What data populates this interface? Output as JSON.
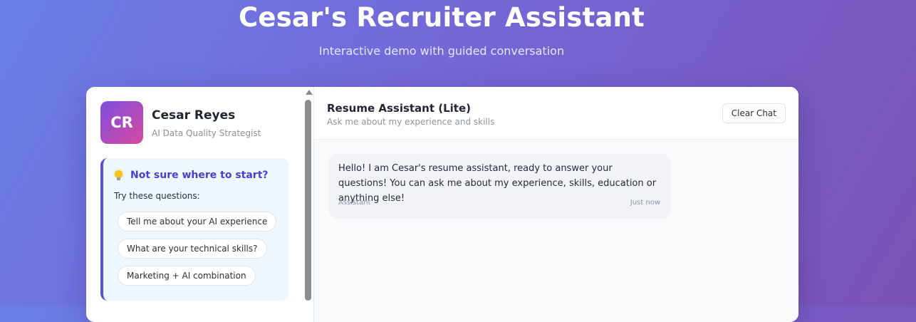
{
  "page": {
    "title": "Cesar's Recruiter Assistant",
    "subtitle": "Interactive demo with guided conversation"
  },
  "profile": {
    "initials": "CR",
    "name": "Cesar Reyes",
    "role": "AI Data Quality Strategist"
  },
  "suggestions": {
    "icon": "lightbulb-icon",
    "title": "Not sure where to start?",
    "prompt": "Try these questions:",
    "items": [
      "Tell me about your AI experience",
      "What are your technical skills?",
      "Marketing + AI combination"
    ]
  },
  "chat": {
    "title": "Resume Assistant (Lite)",
    "subtitle": "Ask me about my experience and skills",
    "clear_label": "Clear Chat",
    "messages": [
      {
        "text": "Hello! I am Cesar's resume assistant, ready to answer your questions! You can ask me about my experience, skills, education or anything else!",
        "sender": "Assistant",
        "time": "Just now"
      }
    ]
  },
  "colors": {
    "accent": "#4a3fcf",
    "avatar_gradient_start": "#7c4de0",
    "avatar_gradient_end": "#d84a9e",
    "background_start": "#6a7fe8",
    "background_end": "#7a52b4"
  }
}
